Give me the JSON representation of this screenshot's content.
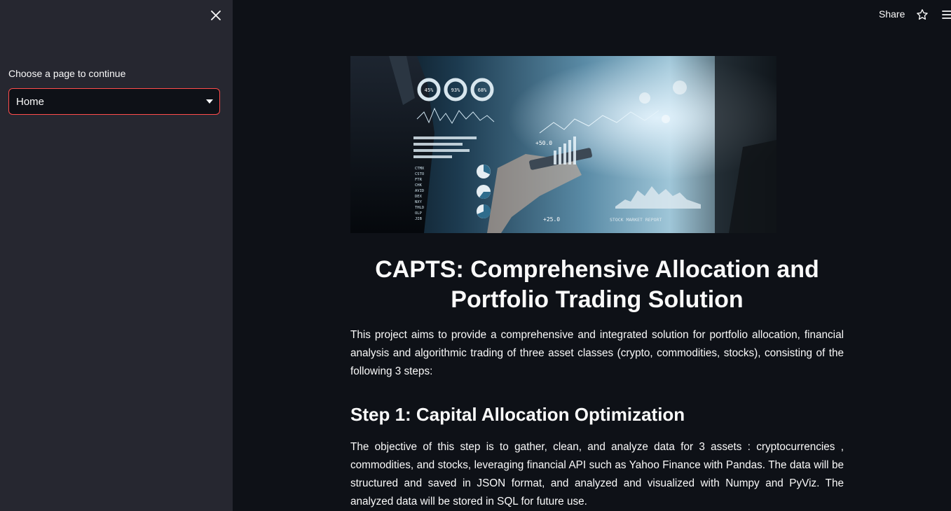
{
  "sidebar": {
    "select_label": "Choose a page to continue",
    "selected_page": "Home",
    "accent_color": "#ff4b4b"
  },
  "topbar": {
    "share_label": "Share"
  },
  "hero": {
    "gauges": [
      "45%",
      "93%",
      "68%"
    ],
    "upper_value": "+50.0",
    "lower_value": "+25.0",
    "report_label": "STOCK MARKET REPORT",
    "ticker_codes": [
      "CTMX",
      "CSTO",
      "FTR",
      "CHK",
      "AVID",
      "DEX",
      "NXY",
      "THLD",
      "OLP",
      "JIB"
    ]
  },
  "main": {
    "title": "CAPTS: Comprehensive Allocation and Portfolio Trading Solution",
    "intro": "This project aims to provide a comprehensive and integrated solution for portfolio allocation, financial analysis and algorithmic trading of three asset classes (crypto, commodities, stocks), consisting of the following 3 steps:",
    "step1_heading": "Step 1: Capital Allocation Optimization",
    "step1_text": "The objective of this step is to gather, clean, and analyze data for 3 assets : cryptocurrencies , commodities, and stocks, leveraging financial API such as Yahoo Finance with Pandas. The data will be structured and saved in JSON format, and analyzed and visualized with Numpy and PyViz. The analyzed data will be stored in SQL for future use."
  }
}
